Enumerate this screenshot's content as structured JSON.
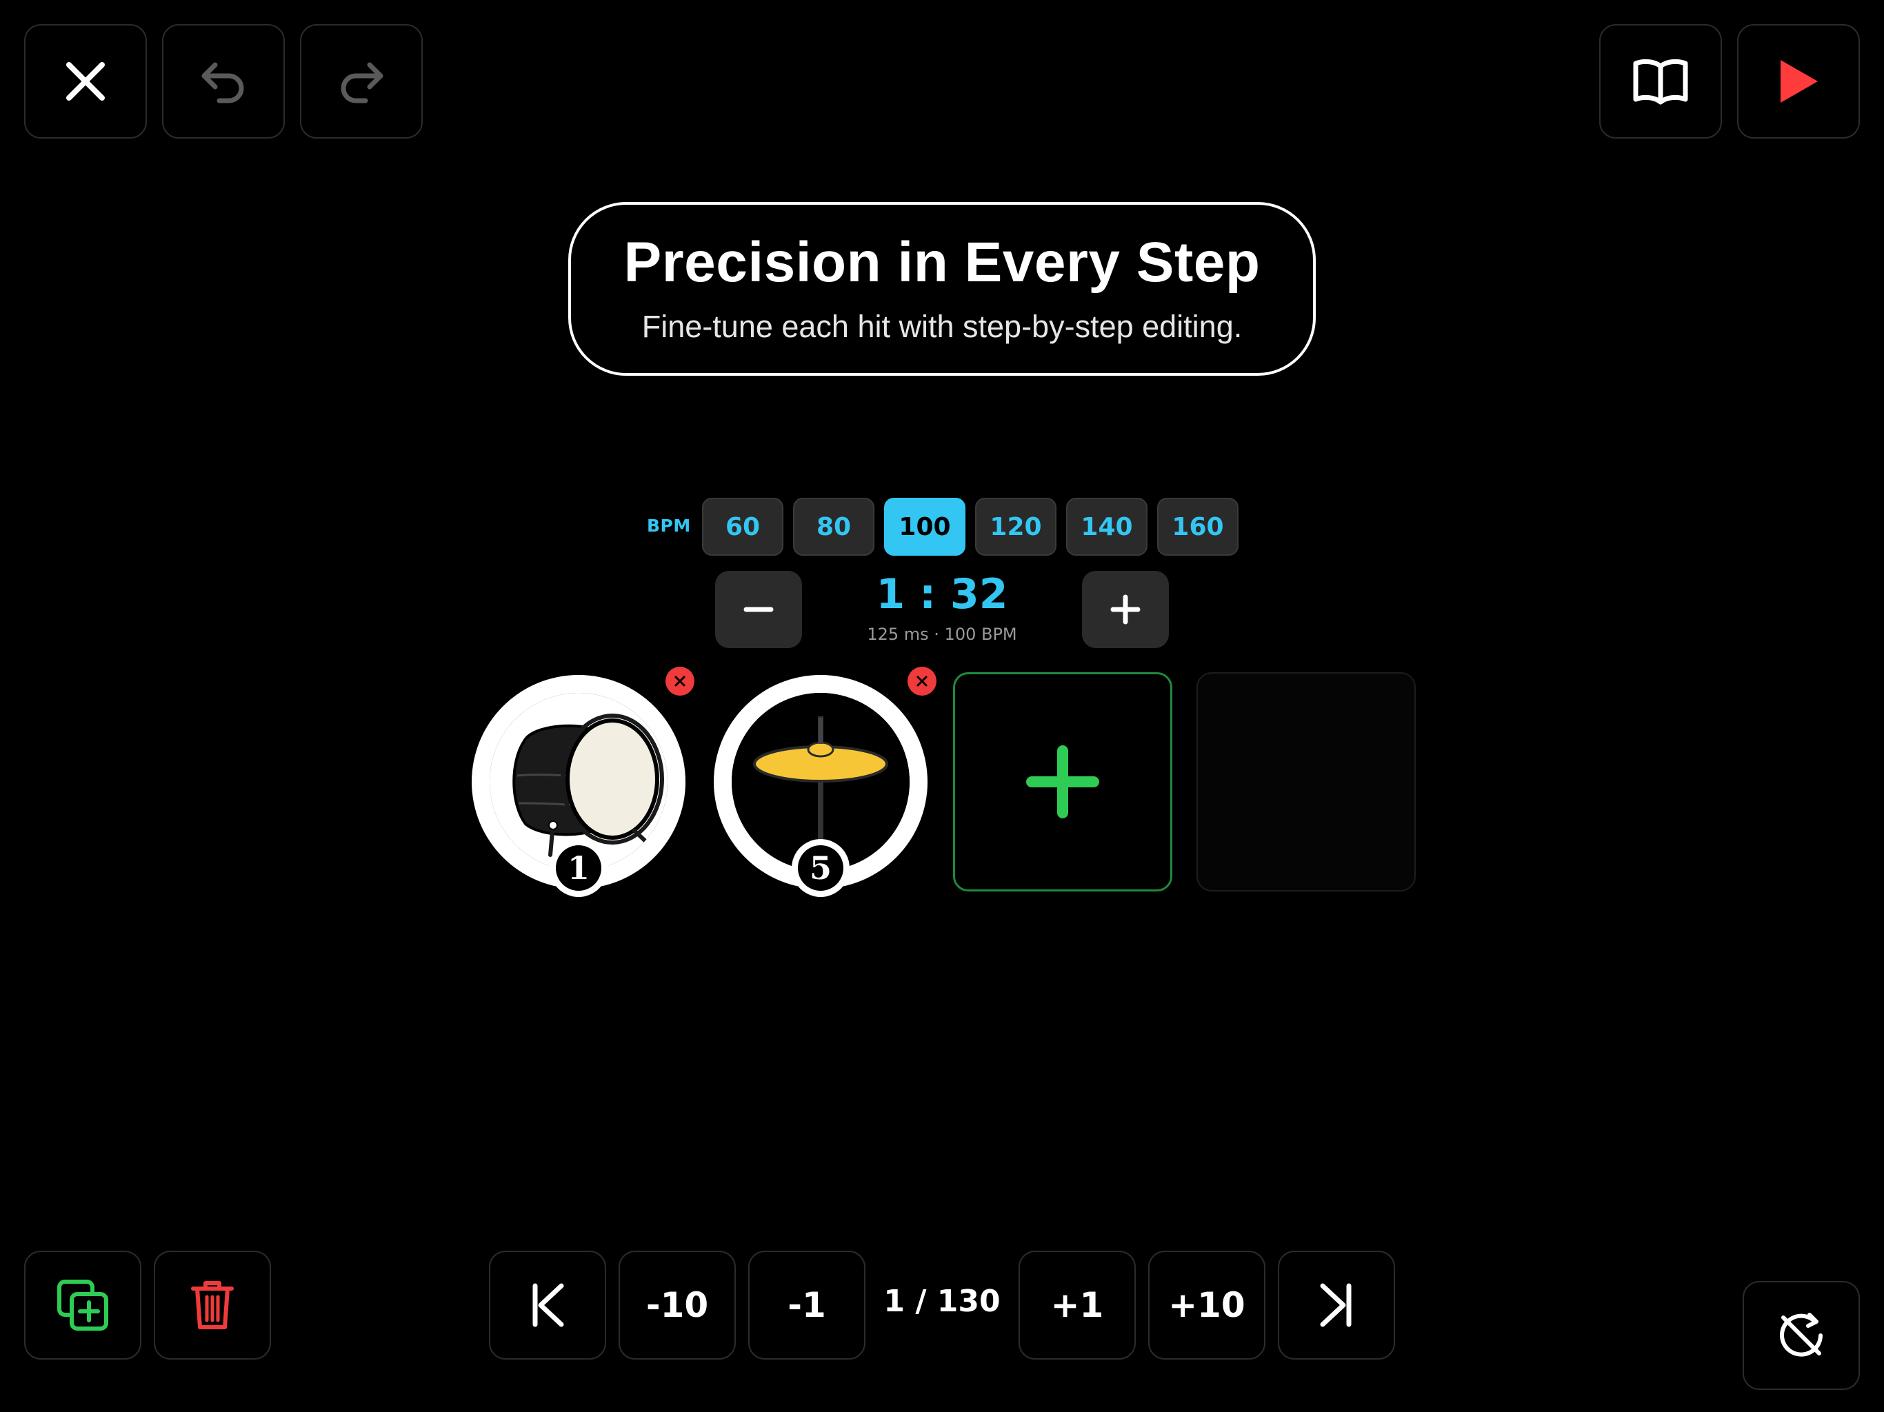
{
  "toolbar": {
    "close_icon": "close-icon",
    "undo_icon": "undo-icon",
    "redo_icon": "redo-icon",
    "guide_icon": "book-icon",
    "play_icon": "play-icon"
  },
  "banner": {
    "title": "Precision in Every Step",
    "subtitle": "Fine-tune each hit with step-by-step editing."
  },
  "bpm": {
    "label": "BPM",
    "options": [
      "60",
      "80",
      "100",
      "120",
      "140",
      "160"
    ],
    "selected": "100"
  },
  "step": {
    "value": "1 : 32",
    "detail": "125 ms · 100 BPM",
    "decrease_label": "−",
    "increase_label": "+"
  },
  "slots": [
    {
      "instrument": "bass-drum",
      "number": "1"
    },
    {
      "instrument": "cymbal",
      "number": "5"
    }
  ],
  "navigation": {
    "first_icon": "skip-first-icon",
    "minus10": "-10",
    "minus1": "-1",
    "counter": "1 / 130",
    "plus1": "+1",
    "plus10": "+10",
    "last_icon": "skip-last-icon"
  },
  "colors": {
    "accent": "#33c6f2",
    "add": "#2ecc54",
    "danger": "#ef3b3b",
    "play": "#ff3b3b"
  }
}
